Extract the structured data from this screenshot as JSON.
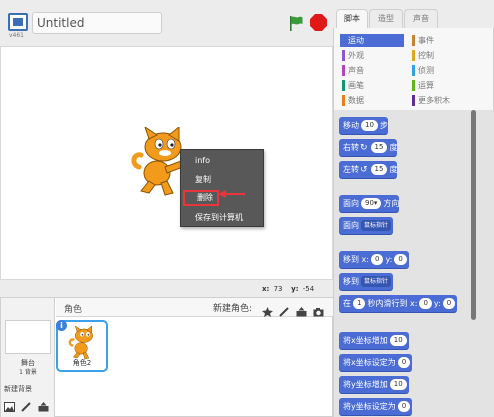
{
  "stage_header": {
    "version": "v461",
    "project_title": "Untitled"
  },
  "stage": {
    "coords": {
      "x_label": "x:",
      "x_value": "73",
      "y_label": "y:",
      "y_value": "-54"
    },
    "context_menu": {
      "items": [
        "info",
        "复制",
        "删除",
        "保存到计算机"
      ]
    }
  },
  "sprites_panel": {
    "title": "角色",
    "new_sprite_label": "新建角色:",
    "stage_label": "舞台",
    "backdrop_count": "1 背景",
    "new_backdrop_label": "新建背景",
    "sprite_name": "角色2"
  },
  "tabs": [
    "脚本",
    "造型",
    "声音"
  ],
  "categories": [
    {
      "label": "运动",
      "color": "#4a6cd4"
    },
    {
      "label": "事件",
      "color": "#c88330"
    },
    {
      "label": "外观",
      "color": "#8a55d7"
    },
    {
      "label": "控制",
      "color": "#e1a91a"
    },
    {
      "label": "声音",
      "color": "#bb42c3"
    },
    {
      "label": "侦测",
      "color": "#2ca5e2"
    },
    {
      "label": "画笔",
      "color": "#0e9a6c"
    },
    {
      "label": "运算",
      "color": "#5cb712"
    },
    {
      "label": "数据",
      "color": "#ee7d16"
    },
    {
      "label": "更多积木",
      "color": "#632d99"
    }
  ],
  "blocks": {
    "move": {
      "label": "移动",
      "value": "10",
      "unit": "步"
    },
    "turn_right": {
      "label": "右转",
      "value": "15",
      "unit": "度"
    },
    "turn_left": {
      "label": "左转",
      "value": "15",
      "unit": "度"
    },
    "point_dir": {
      "label": "面向",
      "value": "90▾",
      "unit": "方向"
    },
    "point_towards": {
      "label": "面向",
      "drop": "鼠标指针"
    },
    "goto_xy": {
      "label": "移到 x:",
      "x": "0",
      "y_label": "y:",
      "y": "0"
    },
    "goto": {
      "label": "移到",
      "drop": "鼠标指针"
    },
    "glide": {
      "label": "在",
      "secs": "1",
      "mid": "秒内滑行到 x:",
      "x": "0",
      "y_label": "y:",
      "y": "0"
    },
    "change_x": {
      "label": "将x坐标增加",
      "value": "10"
    },
    "set_x": {
      "label": "将x坐标设定为",
      "value": "0"
    },
    "change_y": {
      "label": "将y坐标增加",
      "value": "10"
    },
    "set_y": {
      "label": "将y坐标设定为",
      "value": "0"
    }
  },
  "colors": {
    "motion": "#4a6cd4",
    "highlight": "#e8363c",
    "stop": "#e01818",
    "flag": "#3a9a3a"
  }
}
